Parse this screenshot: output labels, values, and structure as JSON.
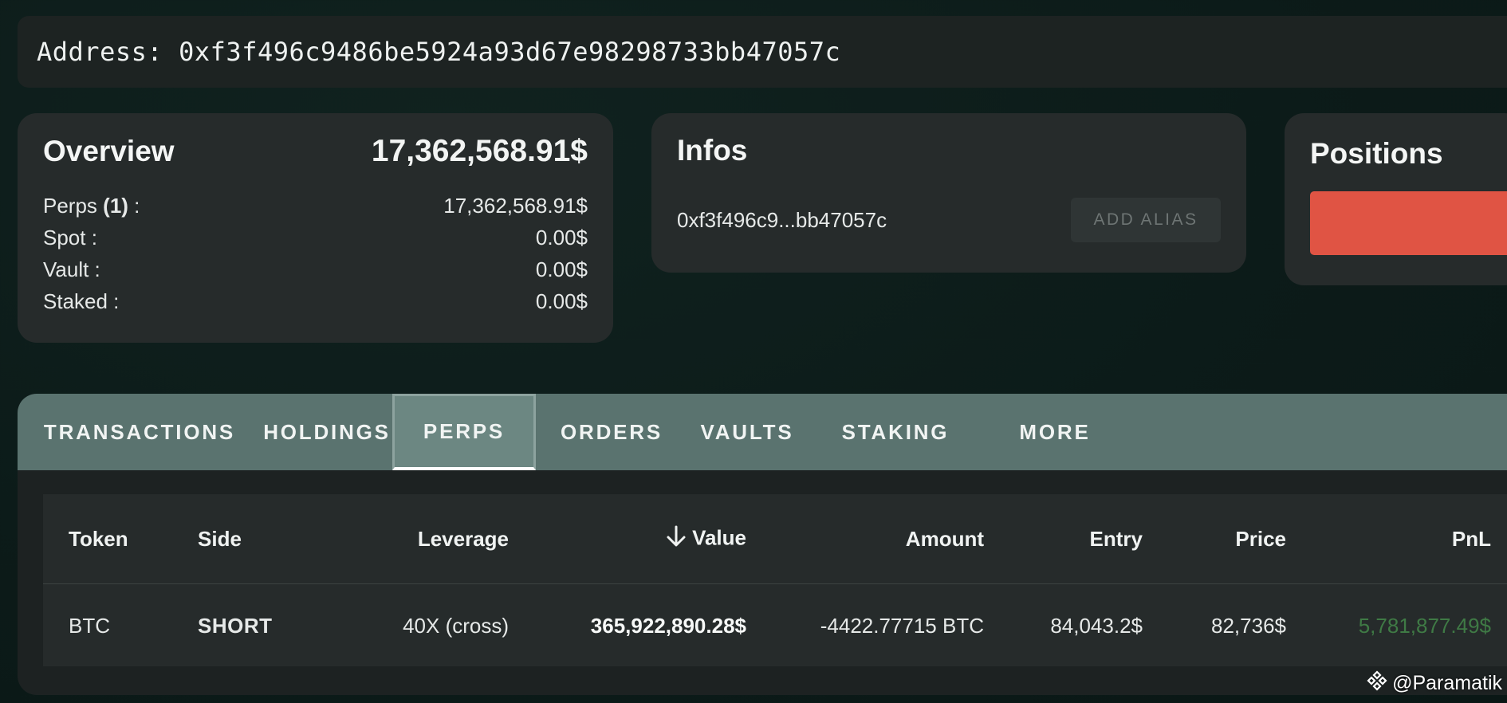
{
  "address_bar": {
    "label": "Address:",
    "address": "0xf3f496c9486be5924a93d67e98298733bb47057c"
  },
  "overview": {
    "title": "Overview",
    "total": "17,362,568.91$",
    "rows": [
      {
        "label": "Perps",
        "count": "(1)",
        "suffix": " :",
        "value": "17,362,568.91$"
      },
      {
        "label": "Spot :",
        "value": "0.00$"
      },
      {
        "label": "Vault :",
        "value": "0.00$"
      },
      {
        "label": "Staked :",
        "value": "0.00$"
      }
    ]
  },
  "infos": {
    "title": "Infos",
    "short_address": "0xf3f496c9...bb47057c",
    "alias_button": "ADD ALIAS"
  },
  "positions": {
    "title": "Positions",
    "bar_color": "#e05444"
  },
  "tabs": [
    "TRANSACTIONS",
    "HOLDINGS",
    "PERPS",
    "ORDERS",
    "VAULTS",
    "STAKING",
    "MORE"
  ],
  "active_tab": "PERPS",
  "table": {
    "headers": {
      "token": "Token",
      "side": "Side",
      "leverage": "Leverage",
      "value": "Value",
      "amount": "Amount",
      "entry": "Entry",
      "price": "Price",
      "pnl": "PnL"
    },
    "sort_icon": "arrow-down-icon",
    "rows": [
      {
        "token": "BTC",
        "side": "SHORT",
        "leverage": "40X (cross)",
        "value": "365,922,890.28$",
        "amount": "-4422.77715 BTC",
        "entry": "84,043.2$",
        "price": "82,736$",
        "pnl": "5,781,877.49$"
      }
    ]
  },
  "colors": {
    "short": "#e0443a",
    "pnl_positive": "#3f7a45",
    "tab_bar": "#5a736f"
  },
  "watermark": {
    "icon": "binance-logo-icon",
    "text": "@Paramatik"
  }
}
